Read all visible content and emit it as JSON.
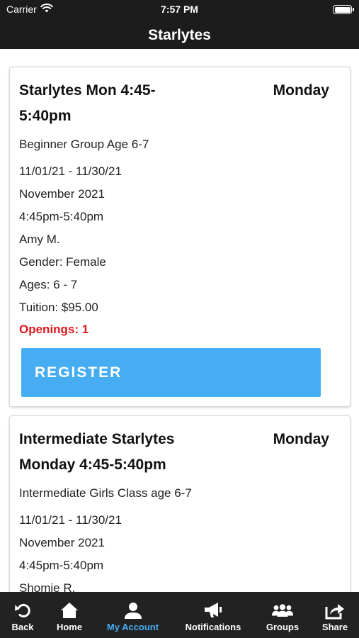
{
  "status_bar": {
    "carrier": "Carrier",
    "time": "7:57 PM",
    "battery_level": 1.0
  },
  "header": {
    "title": "Starlytes"
  },
  "classes": [
    {
      "title_line1": "Starlytes Mon 4:45-",
      "title_line2": "5:40pm",
      "day": "Monday",
      "description": "Beginner Group Age 6-7",
      "date_range": "11/01/21 - 11/30/21",
      "month": "November 2021",
      "time": "4:45pm-5:40pm",
      "instructor": "Amy M.",
      "gender": "Gender: Female",
      "ages": "Ages: 6 - 7",
      "tuition": "Tuition: $95.00",
      "openings": "Openings: 1",
      "register_label": "REGISTER"
    },
    {
      "title_line1": "Intermediate Starlytes",
      "title_line2": "Monday 4:45-5:40pm",
      "day": "Monday",
      "description": "Intermediate Girls Class age 6-7",
      "date_range": "11/01/21 - 11/30/21",
      "month": "November 2021",
      "time": "4:45pm-5:40pm",
      "instructor": "Shomie R."
    }
  ],
  "tab_bar": {
    "items": [
      {
        "label": "Back",
        "icon": "back-arrow-icon"
      },
      {
        "label": "Home",
        "icon": "home-icon"
      },
      {
        "label": "My Account",
        "icon": "user-icon"
      },
      {
        "label": "Notifications",
        "icon": "megaphone-icon"
      },
      {
        "label": "Groups",
        "icon": "groups-icon"
      },
      {
        "label": "Share",
        "icon": "share-icon"
      }
    ],
    "active_color": "#46adf2"
  }
}
